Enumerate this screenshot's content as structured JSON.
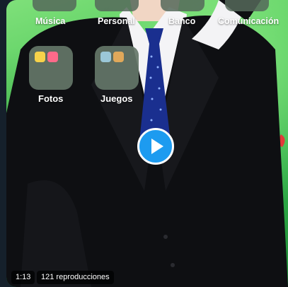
{
  "apps_row_top": {
    "musica": "Música",
    "personal": "Personal",
    "banco": "Banco",
    "comunicacion": "Comunicación"
  },
  "folders": [
    {
      "label": "Fotos"
    },
    {
      "label": "Juegos"
    }
  ],
  "player": {
    "duration": "1:13",
    "views": "121 reproducciones",
    "play_icon": "play-icon"
  },
  "colors": {
    "accent": "#1d9bf0",
    "background_green": "#4fc95a",
    "suit": "#0e0f12",
    "tie": "#1a2f8f"
  }
}
